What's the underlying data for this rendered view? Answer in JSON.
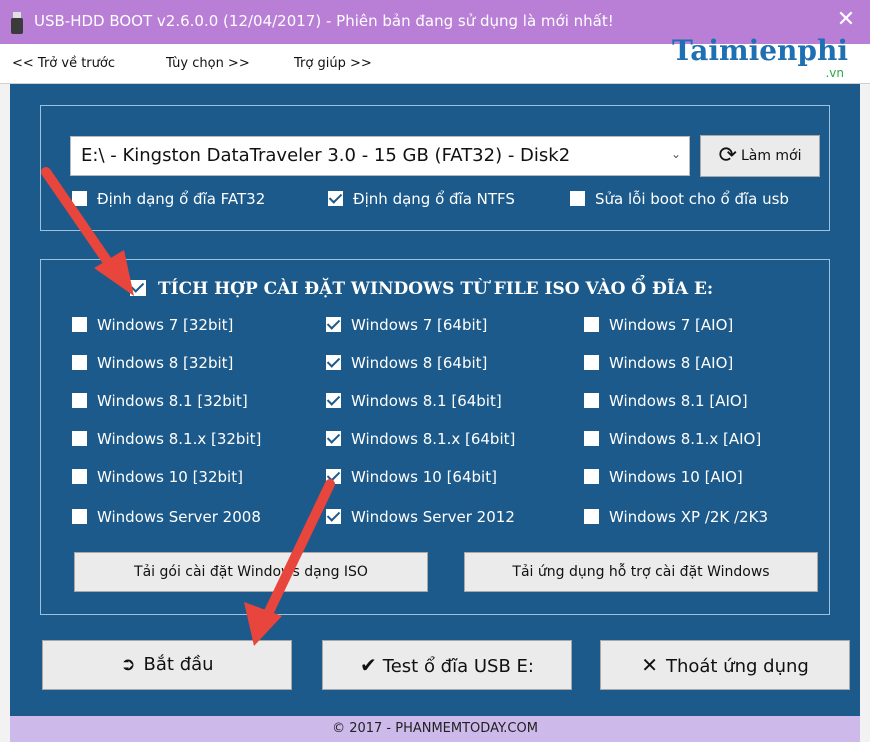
{
  "window": {
    "title": "USB-HDD BOOT v2.6.0.0 (12/04/2017) - Phiên bản đang sử dụng là mới nhất!",
    "close_symbol": "✕"
  },
  "menu": {
    "back": "<< Trở về trước",
    "options": "Tùy chọn >>",
    "help": "Trợ giúp >>"
  },
  "watermark": {
    "brand": "Taimienphi",
    "domain": ".vn"
  },
  "drive": {
    "selected": "E:\\ - Kingston DataTraveler 3.0 - 15 GB (FAT32) - Disk2",
    "refresh_label": "Làm mới"
  },
  "format_options": [
    {
      "label": "Định dạng ổ đĩa FAT32",
      "checked": false
    },
    {
      "label": "Định dạng ổ đĩa NTFS",
      "checked": true
    },
    {
      "label": "Sửa lỗi boot cho ổ đĩa usb",
      "checked": false
    }
  ],
  "integrate": {
    "label": "TÍCH HỢP CÀI ĐẶT WINDOWS TỪ FILE ISO VÀO Ổ ĐĨA E:",
    "checked": true
  },
  "windows_options": [
    [
      "Windows 7 [32bit]",
      "Windows 7 [64bit]",
      "Windows 7 [AIO]"
    ],
    [
      "Windows 8 [32bit]",
      "Windows 8 [64bit]",
      "Windows 8 [AIO]"
    ],
    [
      "Windows 8.1 [32bit]",
      "Windows 8.1 [64bit]",
      "Windows 8.1 [AIO]"
    ],
    [
      "Windows 8.1.x [32bit]",
      "Windows 8.1.x [64bit]",
      "Windows 8.1.x [AIO]"
    ],
    [
      "Windows 10 [32bit]",
      "Windows 10 [64bit]",
      "Windows 10 [AIO]"
    ],
    [
      "Windows Server 2008",
      "Windows Server 2012",
      "Windows XP /2K /2K3"
    ]
  ],
  "windows_checked": [
    [
      false,
      true,
      false
    ],
    [
      false,
      true,
      false
    ],
    [
      false,
      true,
      false
    ],
    [
      false,
      true,
      false
    ],
    [
      false,
      true,
      false
    ],
    [
      false,
      true,
      false
    ]
  ],
  "download": {
    "iso_label": "Tải gói cài đặt Windows dạng ISO",
    "support_label": "Tải ứng dụng hỗ trợ cài đặt Windows"
  },
  "actions": {
    "start_label": "Bắt đầu",
    "test_label": "Test ổ đĩa USB E:",
    "exit_label": "Thoát ứng dụng"
  },
  "footer": "© 2017 - PHANMEMTODAY.COM",
  "colors": {
    "titlebar": "#b97fd6",
    "panel": "#1b5a8a",
    "footer": "#cdb9ea",
    "arrow": "#e8453c"
  }
}
